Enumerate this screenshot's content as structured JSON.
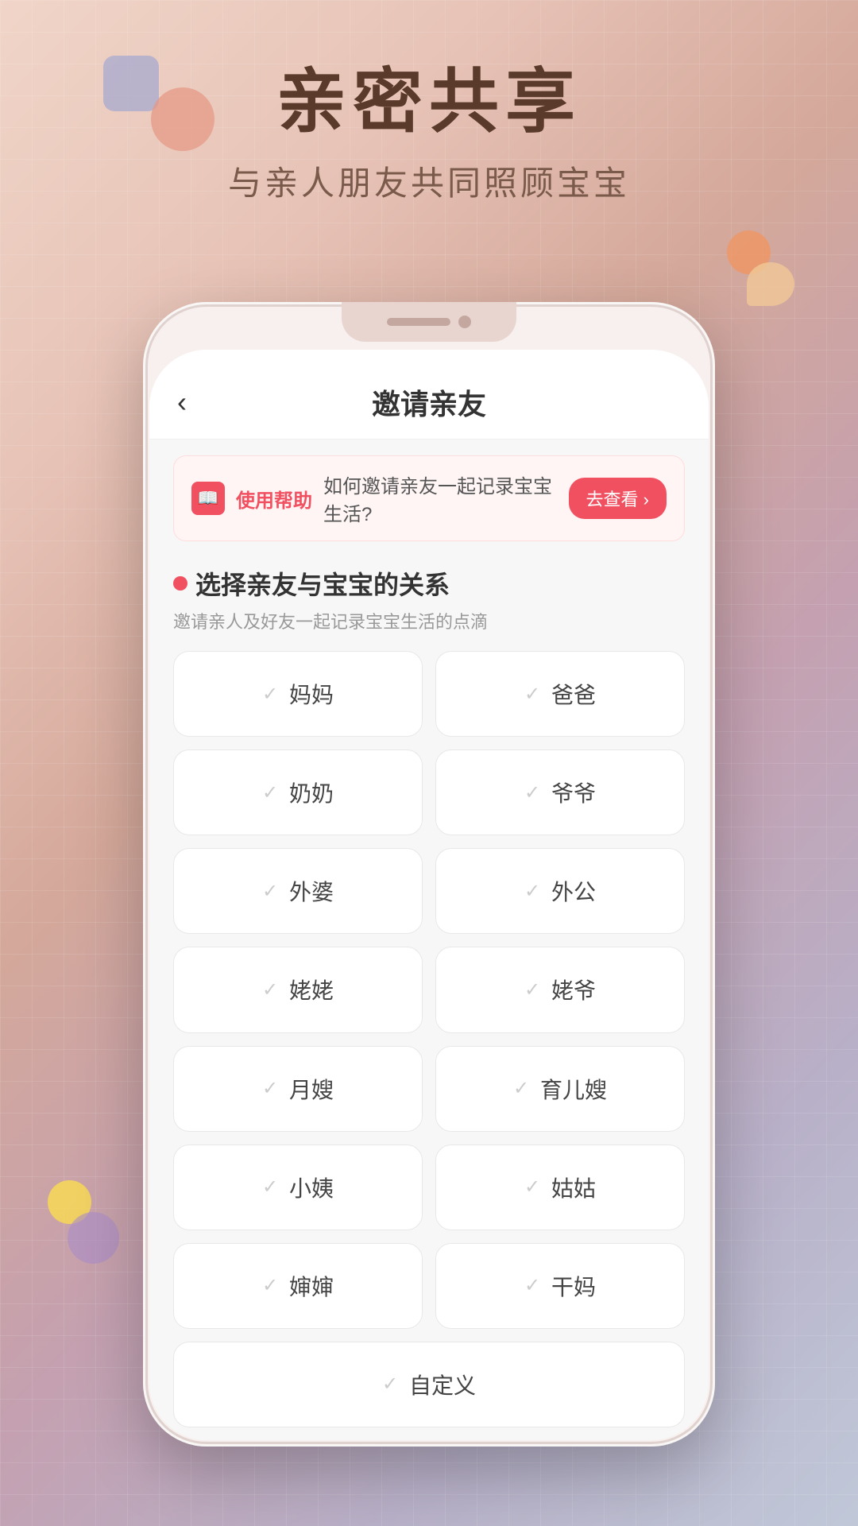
{
  "background": {
    "colors": [
      "#f0d5c8",
      "#d4a89a",
      "#c4a0b0",
      "#b8b0c8"
    ]
  },
  "top": {
    "main_title": "亲密共享",
    "sub_title": "与亲人朋友共同照顾宝宝"
  },
  "phone": {
    "header": {
      "back_label": "‹",
      "title": "邀请亲友"
    },
    "help_banner": {
      "icon": "📖",
      "label": "使用帮助",
      "text": "如何邀请亲友一起记录宝宝生活?",
      "button": "去查看 ›"
    },
    "section": {
      "title": "选择亲友与宝宝的关系",
      "description": "邀请亲人及好友一起记录宝宝生活的点滴"
    },
    "relationships": [
      {
        "label": "妈妈"
      },
      {
        "label": "爸爸"
      },
      {
        "label": "奶奶"
      },
      {
        "label": "爷爷"
      },
      {
        "label": "外婆"
      },
      {
        "label": "外公"
      },
      {
        "label": "姥姥"
      },
      {
        "label": "姥爷"
      },
      {
        "label": "月嫂"
      },
      {
        "label": "育儿嫂"
      },
      {
        "label": "小姨"
      },
      {
        "label": "姑姑"
      },
      {
        "label": "婶婶"
      },
      {
        "label": "干妈"
      }
    ],
    "custom_label": "自定义"
  }
}
